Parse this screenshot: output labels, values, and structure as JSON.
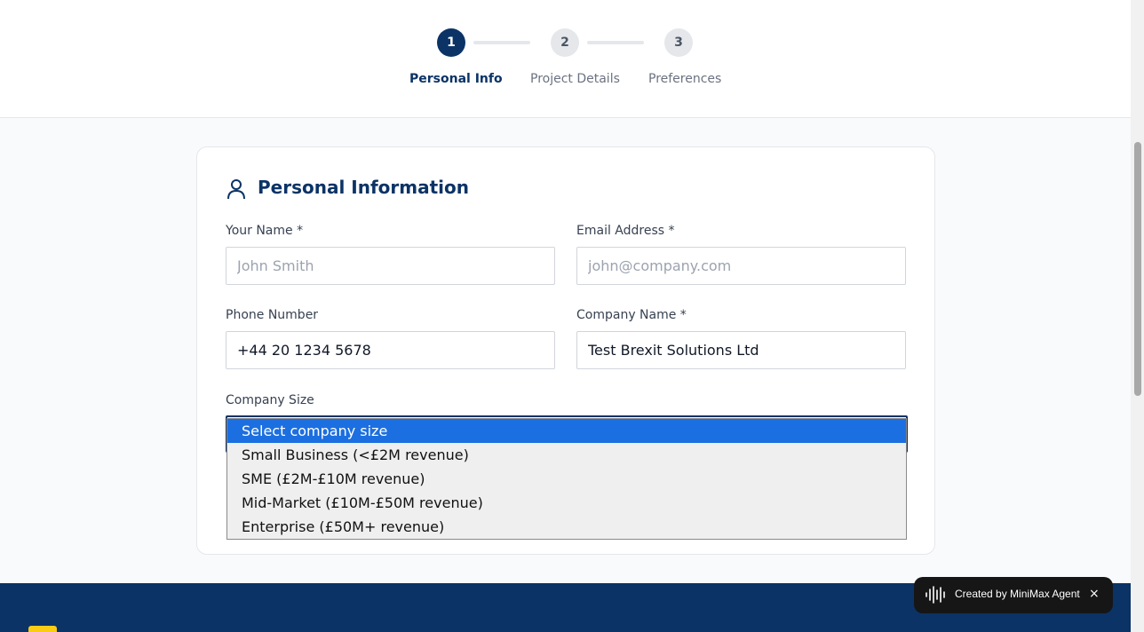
{
  "stepper": {
    "steps": [
      {
        "number": "1",
        "label": "Personal Info",
        "state": "active"
      },
      {
        "number": "2",
        "label": "Project Details",
        "state": "inactive"
      },
      {
        "number": "3",
        "label": "Preferences",
        "state": "inactive"
      }
    ]
  },
  "card": {
    "title": "Personal Information",
    "title_icon": "user-icon"
  },
  "form": {
    "name": {
      "label": "Your Name *",
      "value": "",
      "placeholder": "John Smith"
    },
    "email": {
      "label": "Email Address *",
      "value": "",
      "placeholder": "john@company.com"
    },
    "phone": {
      "label": "Phone Number",
      "value": "+44 20 1234 5678"
    },
    "company": {
      "label": "Company Name *",
      "value": "Test Brexit Solutions Ltd"
    },
    "company_size": {
      "label": "Company Size",
      "selected": "Select company size",
      "options": [
        "Select company size",
        "Small Business (<£2M revenue)",
        "SME (£2M-£10M revenue)",
        "Mid-Market (£10M-£50M revenue)",
        "Enterprise (£50M+ revenue)"
      ]
    }
  },
  "badge": {
    "text": "Created by MiniMax Agent",
    "close": "×",
    "icon": "waveform-icon"
  },
  "colors": {
    "primary": "#0b3366",
    "accent": "#facc15",
    "highlight": "#1c6fe0"
  }
}
